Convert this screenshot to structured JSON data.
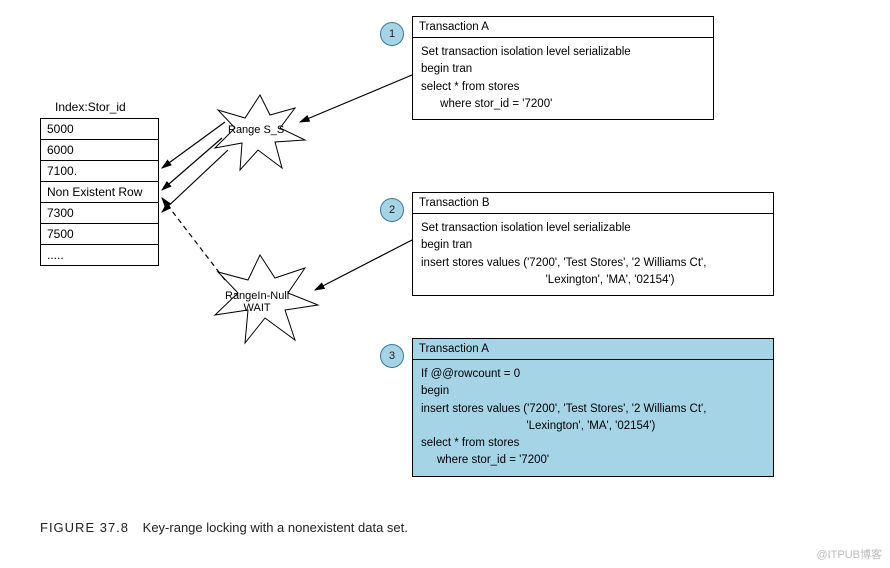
{
  "index": {
    "header": "Index:Stor_id",
    "rows": [
      "5000",
      "6000",
      "7100.",
      "Non Existent Row",
      "7300",
      "7500",
      "....."
    ]
  },
  "bursts": {
    "a": "Range S_S",
    "b": "RangeIn-Null\nWAIT"
  },
  "tx": {
    "a": {
      "header": "Transaction A",
      "body": "Set transaction isolation level serializable\nbegin tran\nselect * from stores\n      where stor_id = '7200'"
    },
    "b": {
      "header": "Transaction B",
      "body": "Set transaction isolation level serializable\nbegin tran\ninsert stores values ('7200', 'Test Stores', '2 Williams Ct',\n                                       'Lexington', 'MA', '02154')"
    },
    "c": {
      "header": "Transaction A",
      "body": "If @@rowcount = 0\nbegin\ninsert stores values ('7200', 'Test Stores', '2 Williams Ct',\n                                 'Lexington', 'MA', '02154')\nselect * from stores\n     where stor_id = '7200'"
    }
  },
  "steps": {
    "one": "1",
    "two": "2",
    "three": "3"
  },
  "caption": {
    "fig": "FIGURE 37.8",
    "text": "Key-range locking with a nonexistent data set."
  },
  "watermark": "@ITPUB博客"
}
